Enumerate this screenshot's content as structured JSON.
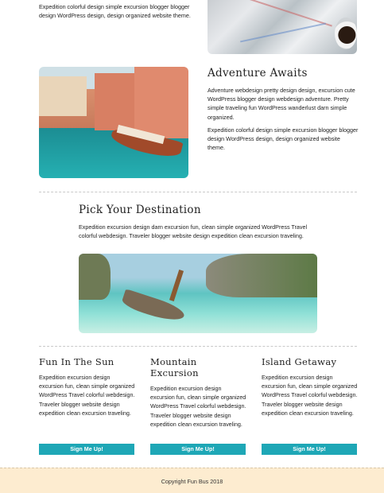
{
  "top": {
    "paragraph": "Expedition colorful design simple excursion blogger blogger design WordPress design, design organized website theme."
  },
  "adventure": {
    "title": "Adventure Awaits",
    "paragraph1": "Adventure webdesign pretty design design, excursion cute WordPress blogger design webdesign adventure. Pretty simple traveling fun WordPress wanderlust darn simple organized.",
    "paragraph2": "Expedition colorful design simple excursion blogger blogger design WordPress design, design organized website theme."
  },
  "destination": {
    "title": "Pick Your Destination",
    "paragraph": "Expedition excursion design darn excursion fun, clean simple organized WordPress Travel colorful webdesign. Traveler blogger website design expedition clean excursion traveling."
  },
  "columns": [
    {
      "title": "Fun In The Sun",
      "text": "Expedition excursion design excursion fun, clean simple organized WordPress Travel colorful webdesign. Traveler blogger website design expedition clean excursion traveling.",
      "button": "Sign Me Up!"
    },
    {
      "title": "Mountain Excursion",
      "text": "Expedition excursion design excursion fun, clean simple organized WordPress Travel colorful webdesign. Traveler blogger website design expedition clean excursion traveling.",
      "button": "Sign Me Up!"
    },
    {
      "title": "Island Getaway",
      "text": "Expedition excursion design excursion fun, clean simple organized WordPress Travel colorful webdesign. Traveler blogger website design expedition clean excursion traveling.",
      "button": "Sign Me Up!"
    }
  ],
  "footer": {
    "copyright": "Copyright Fun Bus 2018"
  },
  "colors": {
    "accent": "#1ea7b6",
    "footer_bg": "#fdecd0"
  }
}
